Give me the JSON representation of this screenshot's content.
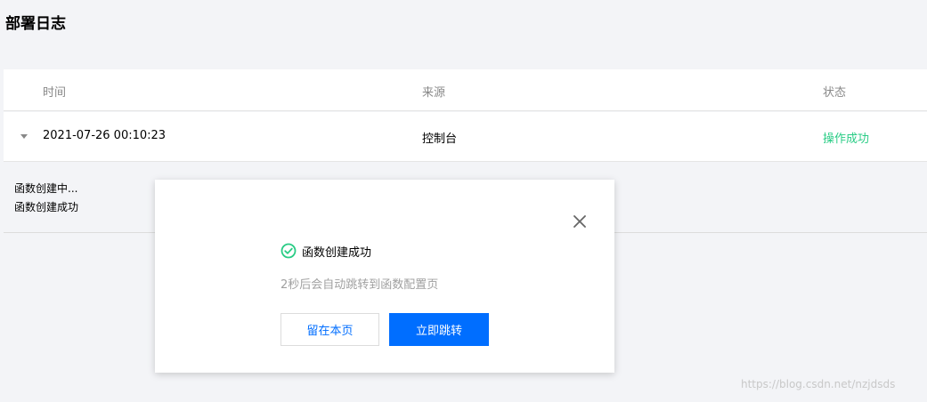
{
  "page": {
    "title": "部署日志"
  },
  "table": {
    "headers": {
      "time": "时间",
      "source": "来源",
      "status": "状态"
    },
    "rows": [
      {
        "time": "2021-07-26 00:10:23",
        "source": "控制台",
        "status": "操作成功",
        "status_color": "#29cc85"
      }
    ]
  },
  "log": {
    "lines": [
      "函数创建中...",
      "函数创建成功"
    ]
  },
  "dialog": {
    "success_message": "函数创建成功",
    "redirect_hint": "2秒后会自动跳转到函数配置页",
    "stay_label": "留在本页",
    "jump_label": "立即跳转",
    "icons": {
      "close": "close-icon",
      "success": "check-circle-icon"
    }
  },
  "watermark": "https://blog.csdn.net/nzjdsds",
  "colors": {
    "primary": "#006eff",
    "success": "#29cc85",
    "background": "#f3f4f7"
  }
}
